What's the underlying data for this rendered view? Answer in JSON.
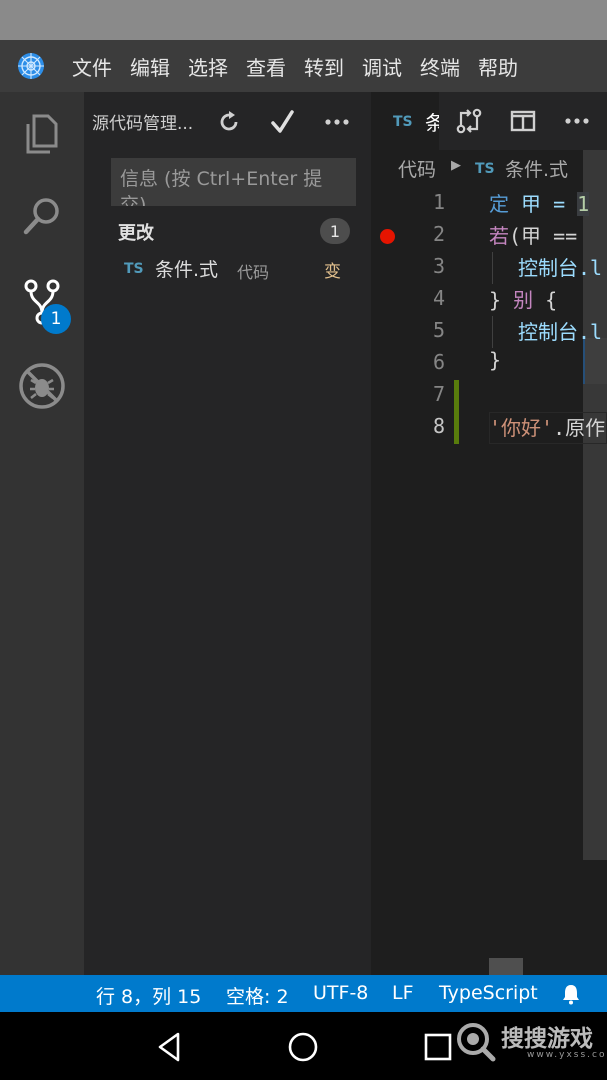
{
  "menubar": {
    "items": [
      "文件",
      "编辑",
      "选择",
      "查看",
      "转到",
      "调试",
      "终端",
      "帮助"
    ]
  },
  "activity": {
    "scm_badge": "1"
  },
  "sidebar": {
    "title": "源代码管理...",
    "message_placeholder": "信息 (按 Ctrl+Enter 提交)",
    "changes_title": "更改",
    "changes_count": "1",
    "change": {
      "icon_text": "TS",
      "file": "条件.式",
      "path": "代码",
      "status": "变"
    }
  },
  "tab": {
    "icon_text": "TS",
    "name": "条件.式"
  },
  "breadcrumb": {
    "folder": "代码",
    "file_icon": "TS",
    "file": "条件.式"
  },
  "editor": {
    "line_numbers": [
      "1",
      "2",
      "3",
      "4",
      "5",
      "6",
      "7",
      "8"
    ],
    "code": {
      "l1_kw": "定",
      "l1_rest": " 甲 = ",
      "l1_num": "1",
      "l2_kw": "若",
      "l2_rest": "(甲 == ",
      "l3": "控制台.l",
      "l4_brace": "} ",
      "l4_kw": "别",
      "l4_rest": " {",
      "l5": "控制台.l",
      "l6": "}",
      "l8_str": "'你好'",
      "l8_rest": ".原作"
    }
  },
  "statusbar": {
    "position": "行 8，列 15",
    "spaces": "空格: 2",
    "encoding": "UTF-8",
    "eol": "LF",
    "language": "TypeScript"
  },
  "watermark": {
    "text": "搜搜游戏",
    "sub": "www.yxss.com"
  },
  "colors": {
    "accent": "#007acc",
    "breakpoint": "#e51400",
    "git_added": "#587c0c"
  }
}
